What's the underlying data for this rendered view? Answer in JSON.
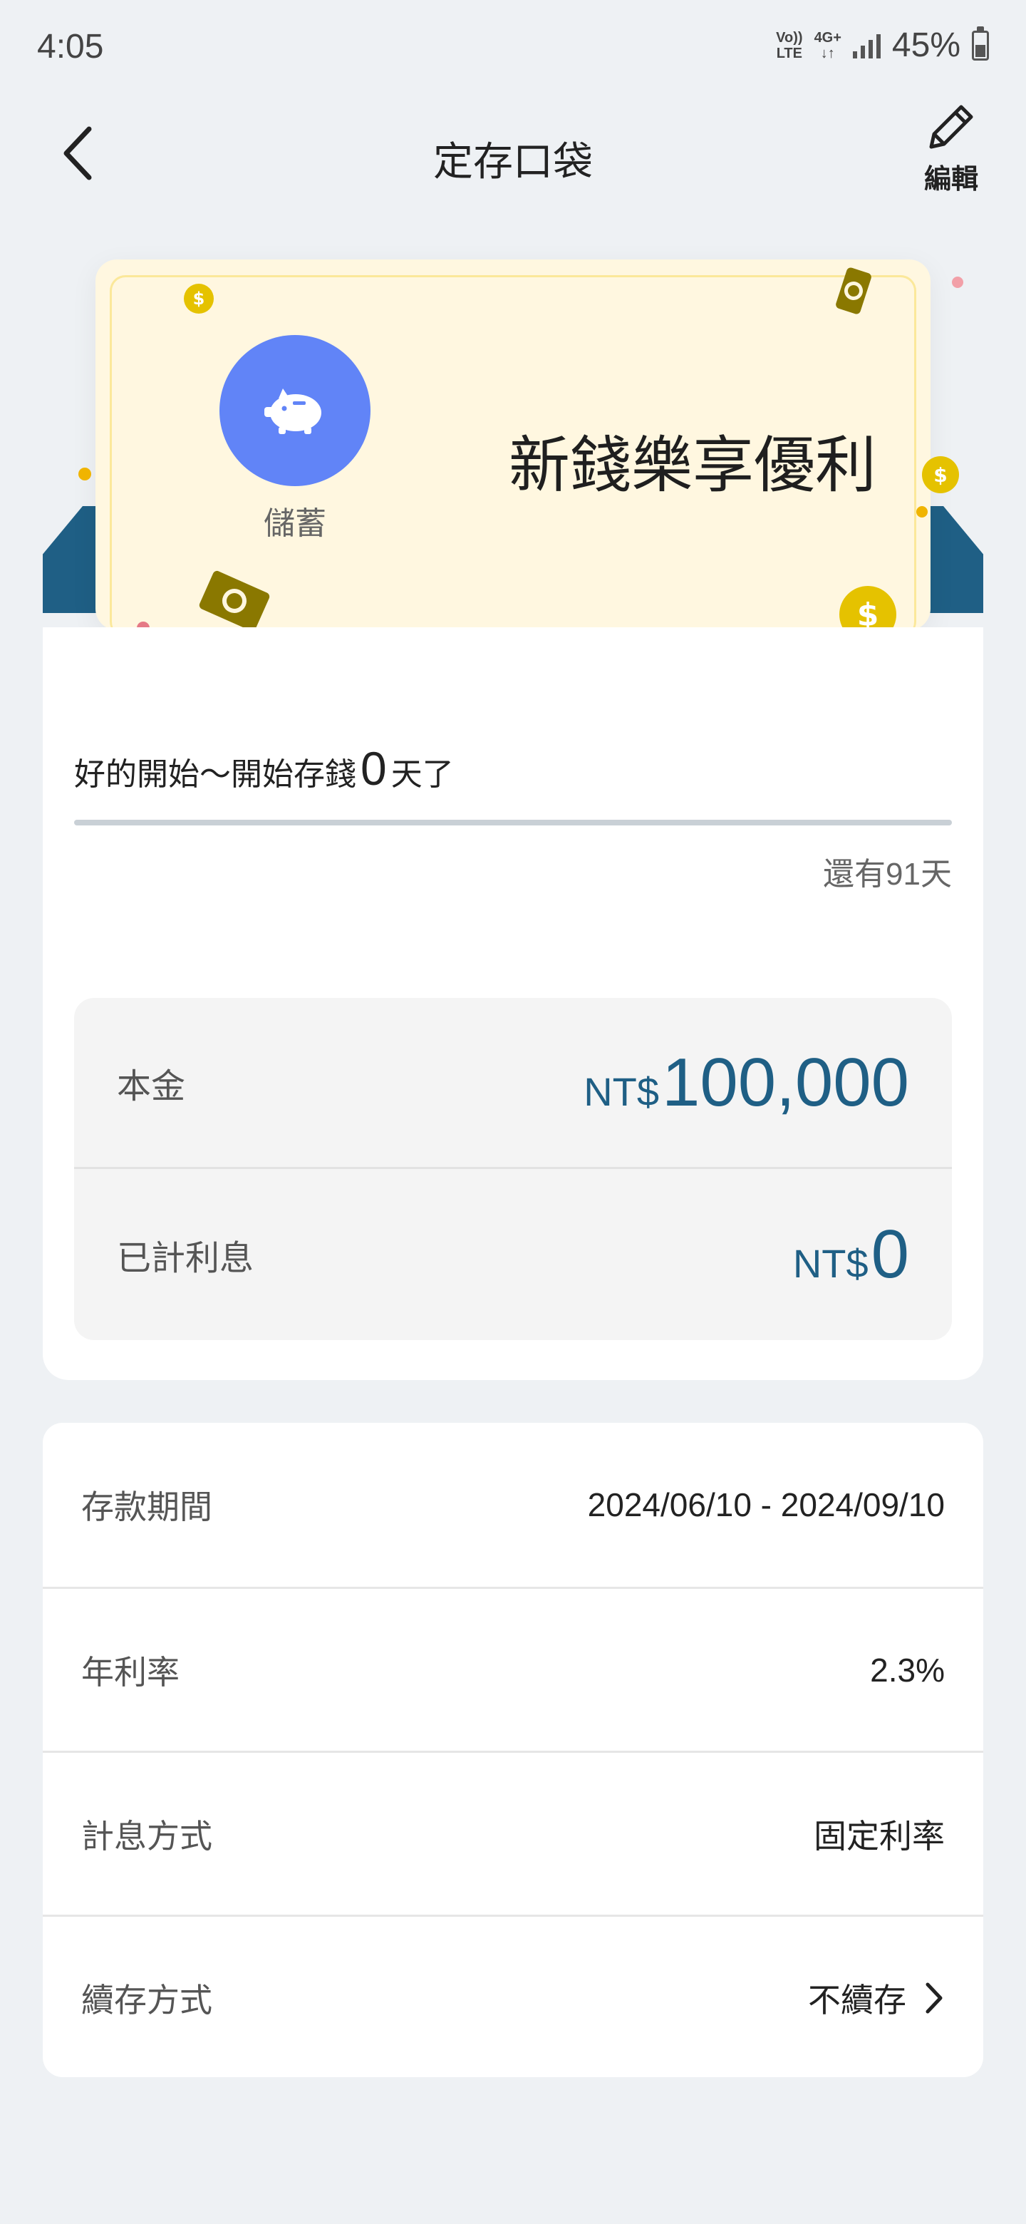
{
  "status_bar": {
    "time": "4:05",
    "volte_top": "Vo))",
    "volte_bottom": "LTE",
    "network_top": "4G+",
    "network_bottom": "↓↑",
    "battery": "45%"
  },
  "header": {
    "title": "定存口袋",
    "edit_label": "編輯"
  },
  "card": {
    "type_label": "儲蓄",
    "name": "新錢樂享優利",
    "colors": {
      "card_bg": "#fff7e0",
      "icon_bg": "#6184f7",
      "ribbon": "#1f5f85",
      "coin": "#e5c200"
    }
  },
  "progress": {
    "prefix": "好的開始～開始存錢",
    "days_elapsed": "0",
    "suffix": "天了",
    "remaining": "還有91天",
    "fraction": 0
  },
  "amounts": {
    "principal_label": "本金",
    "principal_currency": "NT$",
    "principal_value": "100,000",
    "interest_label": "已計利息",
    "interest_currency": "NT$",
    "interest_value": "0"
  },
  "details": [
    {
      "label": "存款期間",
      "value": "2024/06/10 - 2024/09/10"
    },
    {
      "label": "年利率",
      "value": "2.3%"
    },
    {
      "label": "計息方式",
      "value": "固定利率"
    },
    {
      "label": "續存方式",
      "value": "不續存"
    }
  ],
  "icons": {
    "back": "chevron-left-icon",
    "edit": "pencil-icon",
    "pig": "piggy-bank-icon",
    "chevron": "chevron-right-icon"
  }
}
